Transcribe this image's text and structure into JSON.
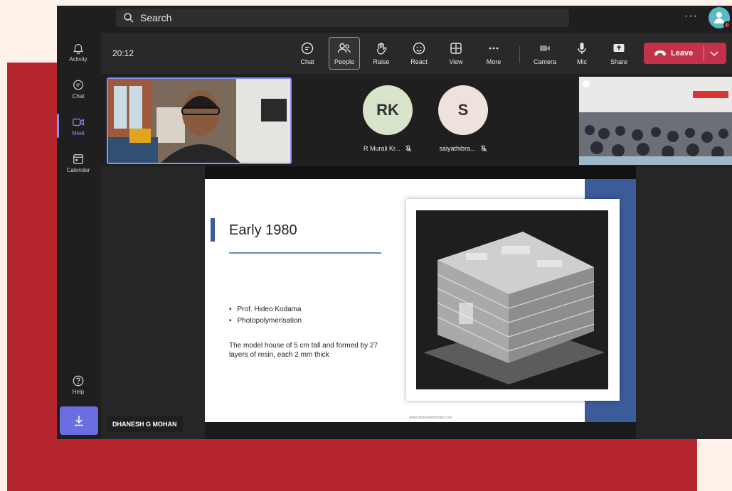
{
  "search": {
    "placeholder": "Search"
  },
  "top": {
    "more": "···"
  },
  "rail": {
    "activity": "Activity",
    "chat": "Chat",
    "meet": "Meet",
    "calendar": "Calendar",
    "help": "Help"
  },
  "toolbar": {
    "timer": "20:12",
    "chat": "Chat",
    "people": "People",
    "raise": "Raise",
    "react": "React",
    "view": "View",
    "more": "More",
    "camera": "Camera",
    "mic": "Mic",
    "share": "Share",
    "leave": "Leave"
  },
  "participants": [
    {
      "initials": "RK",
      "name": "R Murali Kr...",
      "color": "#d8e4c9"
    },
    {
      "initials": "S",
      "name": "saiyathibra...",
      "color": "#efe2dc"
    }
  ],
  "slide": {
    "title": "Early 1980",
    "bullets": [
      "Prof. Hideo Kodama",
      "Photopolymerisation"
    ],
    "description": "The model house of 5 cm tall and formed by 27 layers of resin, each 2 mm thick",
    "footer": "www.dhaneshgmohan.com"
  },
  "presenter": {
    "name": "DHANESH G MOHAN"
  },
  "colors": {
    "accent": "#8b8ff5",
    "leave": "#c4314b",
    "slide_blue": "#3b5b99",
    "frame_red": "#b5262e"
  }
}
